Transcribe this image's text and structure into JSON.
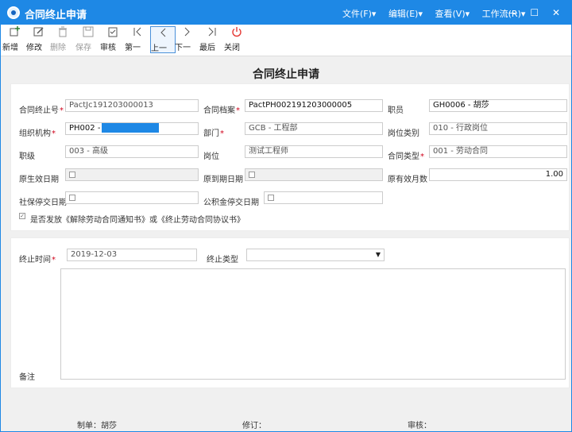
{
  "window": {
    "title": "合同终止申请",
    "menus": [
      "文件(F)▾",
      "编辑(E)▾",
      "查看(V)▾",
      "工作流(R)▾"
    ],
    "controls": {
      "minimize": "—",
      "maximize": "☐",
      "close": "✕"
    }
  },
  "toolbar": {
    "new": "新增",
    "edit": "修改",
    "delete": "删除",
    "save": "保存",
    "audit": "审核",
    "first": "第一",
    "prev": "上一",
    "next": "下一",
    "last": "最后",
    "close": "关闭"
  },
  "page_title": "合同终止申请",
  "form": {
    "contract_no_label": "合同终止号",
    "contract_no": "PactJc191203000013",
    "contract_file_label": "合同档案",
    "contract_file": "PactPH002191203000005",
    "employee_label": "职员",
    "employee": "GH0006 - 胡莎",
    "org_label": "组织机构",
    "org": "PH002 -",
    "dept_label": "部门",
    "dept": "GCB - 工程部",
    "post_type_label": "岗位类别",
    "post_type": "010 - 行政岗位",
    "grade_label": "职级",
    "grade": "003 - 高级",
    "post_label": "岗位",
    "post": "测试工程师",
    "contract_type_label": "合同类型",
    "contract_type": "001 - 劳动合同",
    "orig_start_label": "原生效日期",
    "orig_end_label": "原到期日期",
    "orig_months_label": "原有效月数",
    "orig_months": "1.00",
    "social_label": "社保停交日期",
    "fund_label": "公积金停交日期",
    "notice_checkbox": "是否发放《解除劳动合同通知书》或《终止劳动合同协议书》"
  },
  "termination": {
    "time_label": "终止时间",
    "time": "2019-12-03",
    "type_label": "终止类型",
    "type": "",
    "remark_label": "备注"
  },
  "footer": {
    "maker": "制单：胡莎",
    "revise": "修订：",
    "audit": "审核："
  }
}
